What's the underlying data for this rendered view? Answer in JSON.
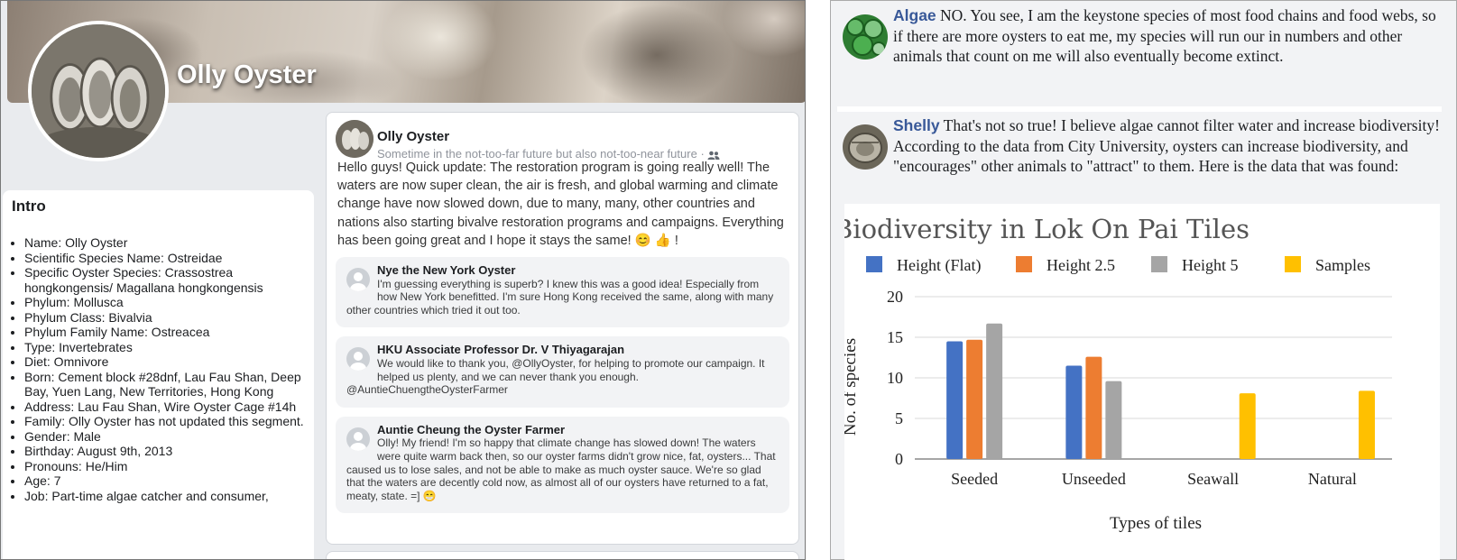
{
  "profile": {
    "name": "Olly Oyster"
  },
  "intro": {
    "title": "Intro",
    "items": [
      "Name: Olly Oyster",
      "Scientific Species Name: Ostreidae",
      "Specific Oyster Species: Crassostrea hongkongensis/ Magallana hongkongensis",
      "Phylum: Mollusca",
      "Phylum Class: Bivalvia",
      "Phylum Family Name: Ostreacea",
      "Type: Invertebrates",
      "Diet: Omnivore",
      "Born: Cement block #28dnf, Lau Fau Shan, Deep Bay, Yuen Lang, New Territories, Hong Kong",
      "Address: Lau Fau Shan, Wire Oyster Cage #14h",
      "Family: Olly Oyster has not updated this segment.",
      "Gender: Male",
      "Birthday: August 9th, 2013",
      "Pronouns: He/Him",
      "Age: 7",
      "Job: Part-time algae catcher and consumer,"
    ]
  },
  "post": {
    "author": "Olly Oyster",
    "time": "Sometime in the not-too-far future but also not-too-near future",
    "audience_separator": "·",
    "body": "Hello guys! Quick update: The restoration program is going really well! The waters are now super clean, the air is fresh, and global warming and climate change have now slowed down, due to many, many, other countries and nations also starting bivalve restoration programs and campaigns. Everything has been going great and I hope it stays the same! 😊 👍 !"
  },
  "comments": [
    {
      "name": "Nye the New York Oyster",
      "text": "I'm guessing everything is superb? I knew this was a good idea! Especially from how New York benefitted. I'm sure Hong Kong received the same, along with many other countries which tried it out too."
    },
    {
      "name": "HKU Associate Professor Dr. V Thiyagarajan",
      "text": "We would like to thank you, @OllyOyster, for helping to promote our campaign. It helped us plenty, and we can never thank you enough. @AuntieChuengtheOysterFarmer"
    },
    {
      "name": "Auntie Cheung the Oyster Farmer",
      "text": "Olly! My friend! I'm so happy that climate change has slowed down! The waters were quite warm back then, so our oyster farms didn't grow nice, fat, oysters... That caused us to lose sales, and not be able to make as much oyster sauce. We're so glad that the waters are decently cold now, as almost all of our oysters have returned to a fat, meaty, state. =] 😁"
    }
  ],
  "chat": [
    {
      "name": "Algae",
      "text": "NO. You see, I am the keystone species of most food chains and food webs, so if there are more oysters to eat me, my species will run our in numbers and other animals that count on me will also eventually become extinct."
    },
    {
      "name": "Shelly",
      "text": "That's not so true! I believe algae cannot filter water and increase biodiversity! According to the data from City University, oysters can increase biodiversity, and \"encourages\" other animals to \"attract\" to them. Here is the data that was found:"
    }
  ],
  "colors": {
    "link_name": "#385898",
    "series_flat": "#4472c4",
    "series_25": "#ed7d31",
    "series_5": "#a5a5a5",
    "series_samples": "#ffc000"
  },
  "chart_data": {
    "type": "bar",
    "title": "Biodiversity in Lok On Pai Tiles",
    "xlabel": "Types of tiles",
    "ylabel": "No. of species",
    "categories": [
      "Seeded",
      "Unseeded",
      "Seawall",
      "Natural"
    ],
    "ylim": [
      0,
      20
    ],
    "yticks": [
      0,
      5,
      10,
      15,
      20
    ],
    "legend_position": "top",
    "grid": true,
    "series": [
      {
        "name": "Height (Flat)",
        "color": "#4472c4",
        "values": [
          14.5,
          11.5,
          null,
          null
        ]
      },
      {
        "name": "Height 2.5",
        "color": "#ed7d31",
        "values": [
          14.7,
          12.6,
          null,
          null
        ]
      },
      {
        "name": "Height 5",
        "color": "#a5a5a5",
        "values": [
          16.7,
          9.6,
          null,
          null
        ]
      },
      {
        "name": "Samples",
        "color": "#ffc000",
        "values": [
          null,
          null,
          8.1,
          8.4
        ]
      }
    ]
  }
}
